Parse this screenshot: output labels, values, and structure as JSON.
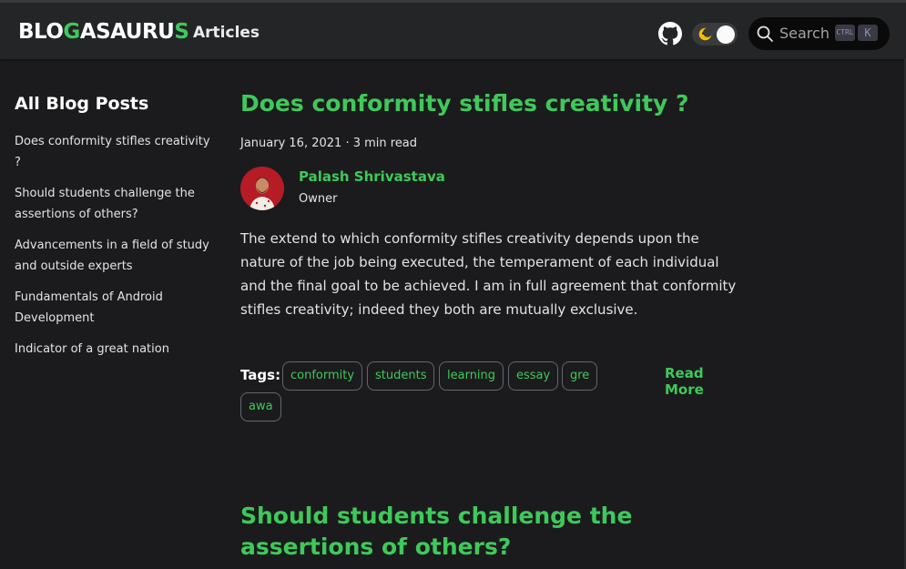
{
  "navbar": {
    "logo": {
      "p1": "BLO",
      "p2": "G",
      "p3": "ASAURU",
      "p4": "S"
    },
    "articles_link": "Articles",
    "search": {
      "placeholder": "Search",
      "key_ctrl": "CTRL",
      "key_k": "K"
    }
  },
  "sidebar": {
    "title": "All Blog Posts",
    "items": [
      {
        "label": "Does conformity stifles creativity ?"
      },
      {
        "label": "Should students challenge the assertions of others?"
      },
      {
        "label": "Advancements in a field of study and outside experts"
      },
      {
        "label": "Fundamentals of Android Development"
      },
      {
        "label": "Indicator of a great nation"
      }
    ]
  },
  "posts": [
    {
      "title": "Does conformity stifles creativity ?",
      "meta": "January 16, 2021 · 3 min read",
      "author": {
        "name": "Palash Shrivastava",
        "role": "Owner"
      },
      "excerpt": "The extend to which conformity stifles creativity depends upon the nature of the job being executed, the temperament of each individual and the final goal to be achieved. I am in full agreement that conformity stifles creativity; indeed they both are mutually exclusive.",
      "tags_label": "Tags:",
      "tags": [
        "conformity",
        "students",
        "learning",
        "essay",
        "gre",
        "awa"
      ],
      "read_more": "Read More"
    },
    {
      "title": "Should students challenge the assertions of others?"
    }
  ],
  "colors": {
    "accent": "#3ec95a",
    "background": "#1b1b1d",
    "navbar": "#242526"
  }
}
